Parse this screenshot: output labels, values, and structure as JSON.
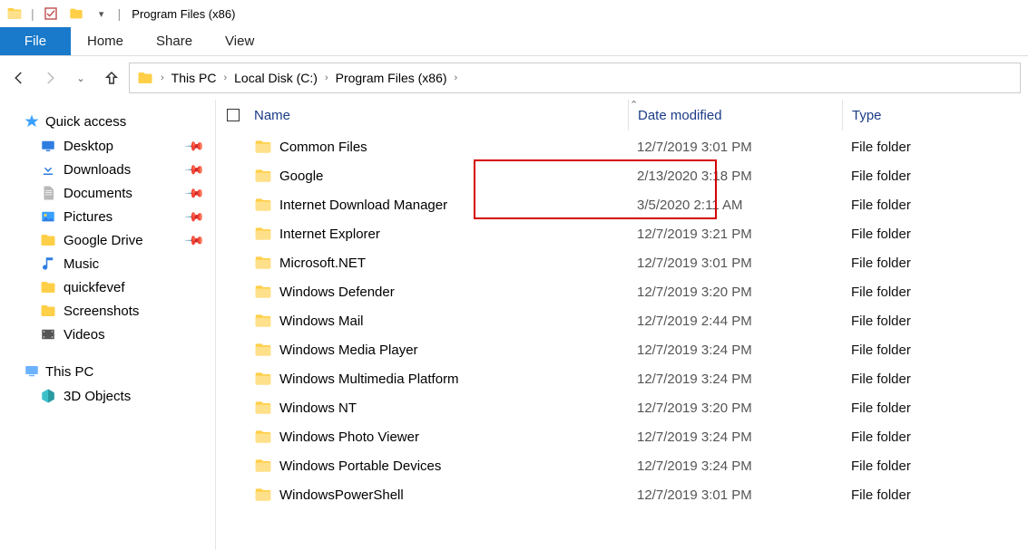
{
  "window_title": "Program Files (x86)",
  "ribbon": {
    "file": "File",
    "home": "Home",
    "share": "Share",
    "view": "View"
  },
  "breadcrumbs": [
    "This PC",
    "Local Disk (C:)",
    "Program Files (x86)"
  ],
  "columns": {
    "name": "Name",
    "date": "Date modified",
    "type": "Type"
  },
  "sidebar": {
    "quick_access": "Quick access",
    "items": [
      {
        "label": "Desktop",
        "pinned": true
      },
      {
        "label": "Downloads",
        "pinned": true
      },
      {
        "label": "Documents",
        "pinned": true
      },
      {
        "label": "Pictures",
        "pinned": true
      },
      {
        "label": "Google Drive",
        "pinned": true
      },
      {
        "label": "Music",
        "pinned": false
      },
      {
        "label": "quickfevef",
        "pinned": false
      },
      {
        "label": "Screenshots",
        "pinned": false
      },
      {
        "label": "Videos",
        "pinned": false
      }
    ],
    "this_pc": "This PC",
    "this_pc_items": [
      {
        "label": "3D Objects"
      }
    ]
  },
  "rows": [
    {
      "name": "Common Files",
      "date": "12/7/2019 3:01 PM",
      "type": "File folder"
    },
    {
      "name": "Google",
      "date": "2/13/2020 3:18 PM",
      "type": "File folder"
    },
    {
      "name": "Internet Download Manager",
      "date": "3/5/2020 2:11 AM",
      "type": "File folder"
    },
    {
      "name": "Internet Explorer",
      "date": "12/7/2019 3:21 PM",
      "type": "File folder"
    },
    {
      "name": "Microsoft.NET",
      "date": "12/7/2019 3:01 PM",
      "type": "File folder"
    },
    {
      "name": "Windows Defender",
      "date": "12/7/2019 3:20 PM",
      "type": "File folder"
    },
    {
      "name": "Windows Mail",
      "date": "12/7/2019 2:44 PM",
      "type": "File folder"
    },
    {
      "name": "Windows Media Player",
      "date": "12/7/2019 3:24 PM",
      "type": "File folder"
    },
    {
      "name": "Windows Multimedia Platform",
      "date": "12/7/2019 3:24 PM",
      "type": "File folder"
    },
    {
      "name": "Windows NT",
      "date": "12/7/2019 3:20 PM",
      "type": "File folder"
    },
    {
      "name": "Windows Photo Viewer",
      "date": "12/7/2019 3:24 PM",
      "type": "File folder"
    },
    {
      "name": "Windows Portable Devices",
      "date": "12/7/2019 3:24 PM",
      "type": "File folder"
    },
    {
      "name": "WindowsPowerShell",
      "date": "12/7/2019 3:01 PM",
      "type": "File folder"
    }
  ]
}
